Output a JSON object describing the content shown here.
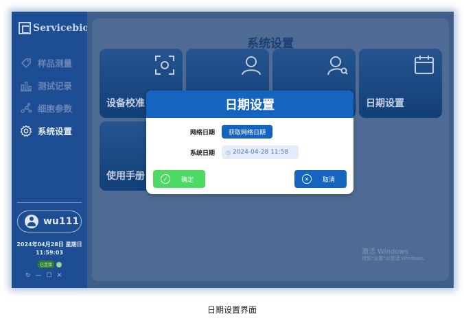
{
  "app": {
    "brand": "Servicebio"
  },
  "sidebar": {
    "items": [
      {
        "label": "样品测量",
        "icon": "tag-icon",
        "active": false
      },
      {
        "label": "测试记录",
        "icon": "bar-chart-icon",
        "active": false
      },
      {
        "label": "细胞参数",
        "icon": "nodes-icon",
        "active": false
      },
      {
        "label": "系统设置",
        "icon": "gear-icon",
        "active": true
      }
    ],
    "user": "wu111",
    "date_line": "2024年04月28日 星期日",
    "time_line": "11:59:03",
    "status_badge": "已连接",
    "window_controls": [
      "↻",
      "—",
      "☐",
      "✕"
    ]
  },
  "main": {
    "title": "系统设置",
    "cards": [
      {
        "label": "设备校准",
        "icon": "scan-icon"
      },
      {
        "label": "",
        "icon": "user-icon"
      },
      {
        "label": "",
        "icon": "user-search-icon"
      },
      {
        "label": "日期设置",
        "icon": "calendar-icon"
      },
      {
        "label": "使用手册",
        "icon": ""
      }
    ],
    "watermark_line1": "激活 Windows",
    "watermark_line2": "转到\"设置\"以激活 Windows。"
  },
  "dialog": {
    "title": "日期设置",
    "network_date_label": "网络日期",
    "network_button": "获取网络日期",
    "system_date_label": "系统日期",
    "system_date_value": "2024-04-28 11:58",
    "ok_label": "确定",
    "cancel_label": "取消"
  },
  "caption": "日期设置界面",
  "colors": {
    "sidebar": "#1d4d93",
    "primary": "#1565c0",
    "ok": "#4cd964"
  }
}
